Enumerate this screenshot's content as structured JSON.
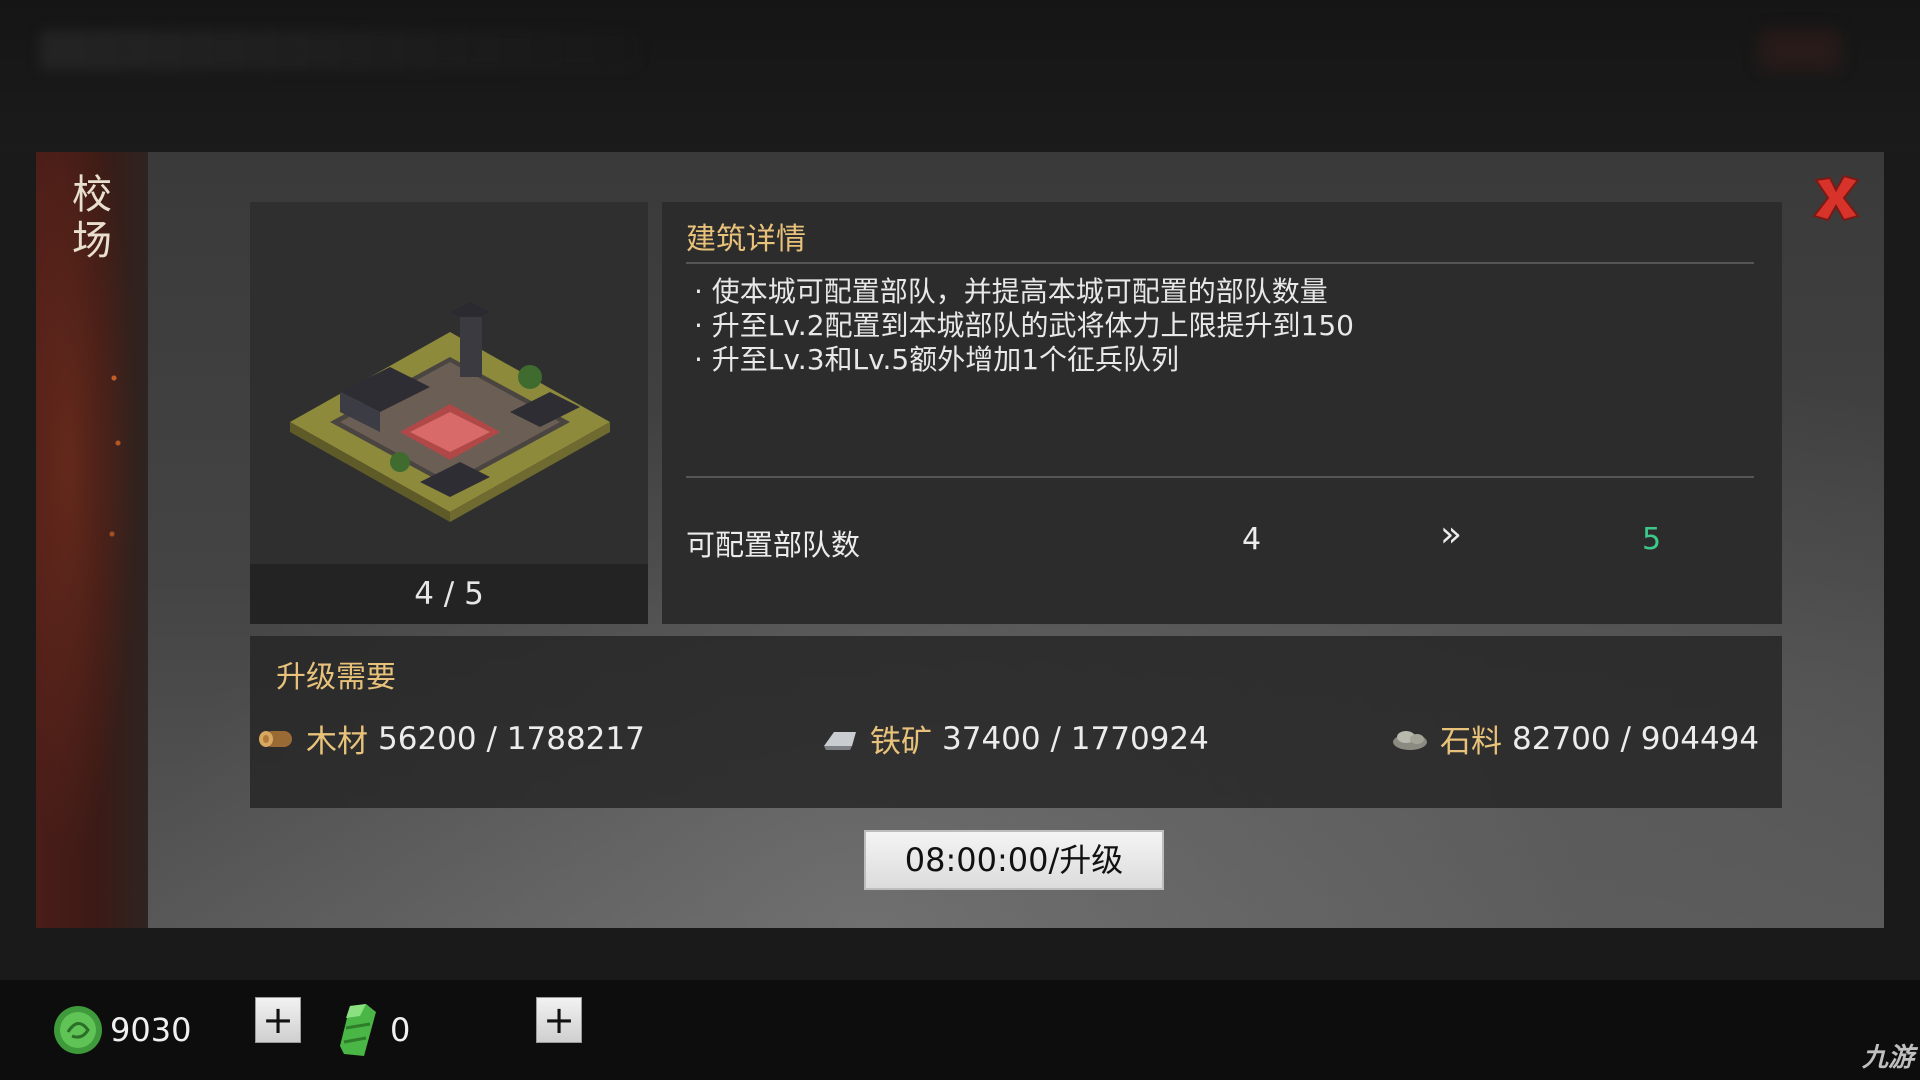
{
  "dialog": {
    "title": "校场",
    "details_title": "建筑详情",
    "bullets": [
      "· 使本城可配置部队，并提高本城可配置的部队数量",
      "· 升至Lv.2配置到本城部队的武将体力上限提升到150",
      "· 升至Lv.3和Lv.5额外增加1个征兵队列"
    ],
    "level": "4 / 5",
    "stat": {
      "label": "可配置部队数",
      "current": "4",
      "arrow": "»",
      "next": "5"
    }
  },
  "requirements": {
    "title": "升级需要",
    "resources": [
      {
        "icon": "wood-icon",
        "name": "木材",
        "value": "56200 / 1788217"
      },
      {
        "icon": "iron-ore-icon",
        "name": "铁矿",
        "value": "37400 / 1770924"
      },
      {
        "icon": "stone-icon",
        "name": "石料",
        "value": "82700 / 904494"
      }
    ]
  },
  "upgrade_button": "08:00:00/升级",
  "bottom_bar": {
    "jade_amount": "9030",
    "token_amount": "0",
    "plus_label": "+"
  },
  "watermark": "九游",
  "colors": {
    "accent_gold": "#e8c27a",
    "next_green": "#3ec98a",
    "close_red": "#d8332b"
  }
}
